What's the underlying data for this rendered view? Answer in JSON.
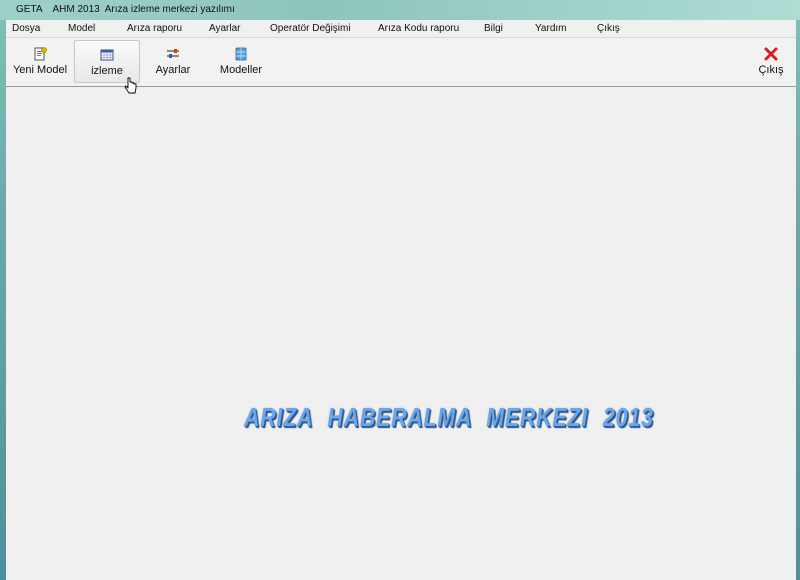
{
  "window": {
    "title": "GETA    AHM 2013  Arıza izleme merkezi yazılımı"
  },
  "menu": {
    "items": [
      {
        "label": "Dosya"
      },
      {
        "label": "Model"
      },
      {
        "label": "Arıza raporu"
      },
      {
        "label": "Ayarlar"
      },
      {
        "label": "Operatör Değişimi"
      },
      {
        "label": "Arıza Kodu raporu"
      },
      {
        "label": "Bilgi"
      },
      {
        "label": "Yardım"
      },
      {
        "label": "Çıkış"
      }
    ]
  },
  "toolbar": {
    "new_model_label": "Yeni Model",
    "monitor_label": "izleme",
    "settings_label": "Ayarlar",
    "models_label": "Modeller",
    "exit_label": "Çıkış"
  },
  "icons": {
    "new_model": "new-model-icon",
    "monitor": "calendar-grid-icon",
    "settings": "sliders-icon",
    "models": "database-icon",
    "exit": "close-x-icon",
    "cursor": "hand-pointer-icon"
  },
  "colors": {
    "banner_text": "#6aa6ec",
    "exit_icon": "#d42020"
  },
  "main": {
    "banner": "ARIZA  HABERALMA  MERKEZI  2013"
  }
}
